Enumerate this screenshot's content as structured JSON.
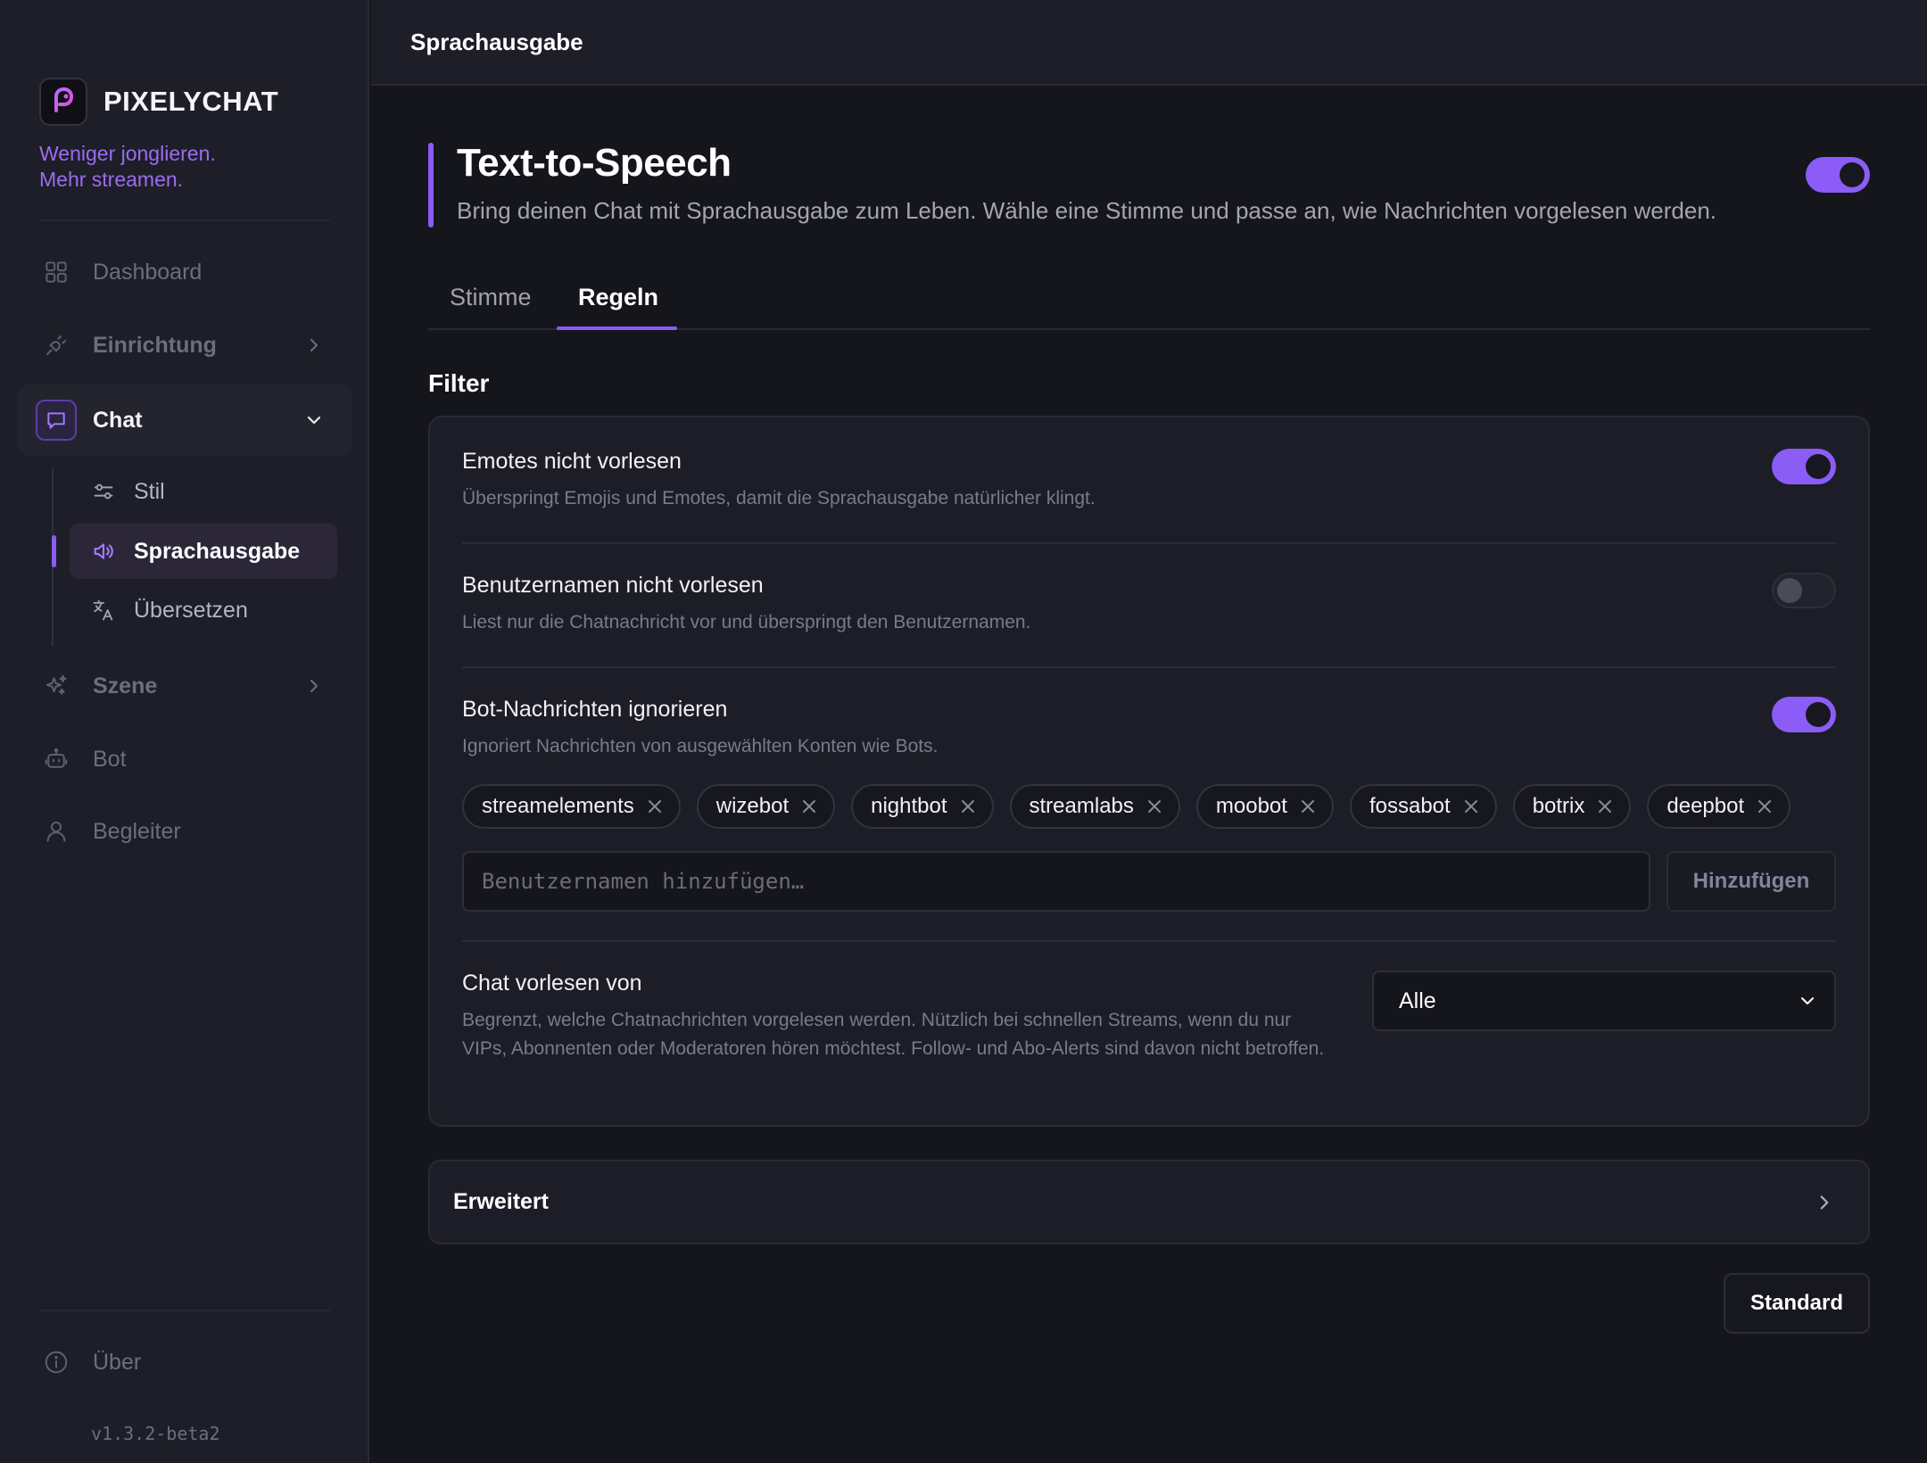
{
  "app": {
    "name": "PIXELYCHAT",
    "tagline": [
      "Weniger jonglieren.",
      "Mehr streamen."
    ],
    "version": "v1.3.2-beta2",
    "accent": "#8b5cf6"
  },
  "sidebar": {
    "items": [
      {
        "label": "Dashboard",
        "icon": "grid-icon"
      },
      {
        "label": "Einrichtung",
        "icon": "plug-icon"
      },
      {
        "label": "Chat",
        "icon": "chat-bubble-icon",
        "expanded": true
      },
      {
        "label": "Szene",
        "icon": "sparkles-icon"
      },
      {
        "label": "Bot",
        "icon": "robot-icon"
      },
      {
        "label": "Begleiter",
        "icon": "user-icon"
      }
    ],
    "chat_children": [
      {
        "label": "Stil",
        "icon": "sliders-icon"
      },
      {
        "label": "Sprachausgabe",
        "icon": "speaker-icon",
        "active": true
      },
      {
        "label": "Übersetzen",
        "icon": "translate-icon"
      }
    ],
    "footer": {
      "label": "Über",
      "icon": "info-icon"
    }
  },
  "topbar": {
    "title": "Sprachausgabe"
  },
  "page": {
    "title": "Text-to-Speech",
    "subtitle": "Bring deinen Chat mit Sprachausgabe zum Leben. Wähle eine Stimme und passe an, wie Nachrichten vorgelesen werden.",
    "enabled": true,
    "tabs": [
      {
        "label": "Stimme",
        "active": false
      },
      {
        "label": "Regeln",
        "active": true
      }
    ]
  },
  "filter": {
    "title": "Filter",
    "rows": [
      {
        "title": "Emotes nicht vorlesen",
        "desc": "Überspringt Emojis und Emotes, damit die Sprachausgabe natürlicher klingt.",
        "enabled": true
      },
      {
        "title": "Benutzernamen nicht vorlesen",
        "desc": "Liest nur die Chatnachricht vor und überspringt den Benutzernamen.",
        "enabled": false
      },
      {
        "title": "Bot-Nachrichten ignorieren",
        "desc": "Ignoriert Nachrichten von ausgewählten Konten wie Bots.",
        "enabled": true
      }
    ],
    "bots": [
      "streamelements",
      "wizebot",
      "nightbot",
      "streamlabs",
      "moobot",
      "fossabot",
      "botrix",
      "deepbot"
    ],
    "add_placeholder": "Benutzernamen hinzufügen…",
    "add_button": "Hinzufügen",
    "chat_from": {
      "title": "Chat vorlesen von",
      "desc": "Begrenzt, welche Chatnachrichten vorgelesen werden. Nützlich bei schnellen Streams, wenn du nur VIPs, Abonnenten oder Moderatoren hören möchtest. Follow- und Abo-Alerts sind davon nicht betroffen.",
      "value": "Alle"
    }
  },
  "advanced": {
    "label": "Erweitert"
  },
  "reset_button": "Standard"
}
